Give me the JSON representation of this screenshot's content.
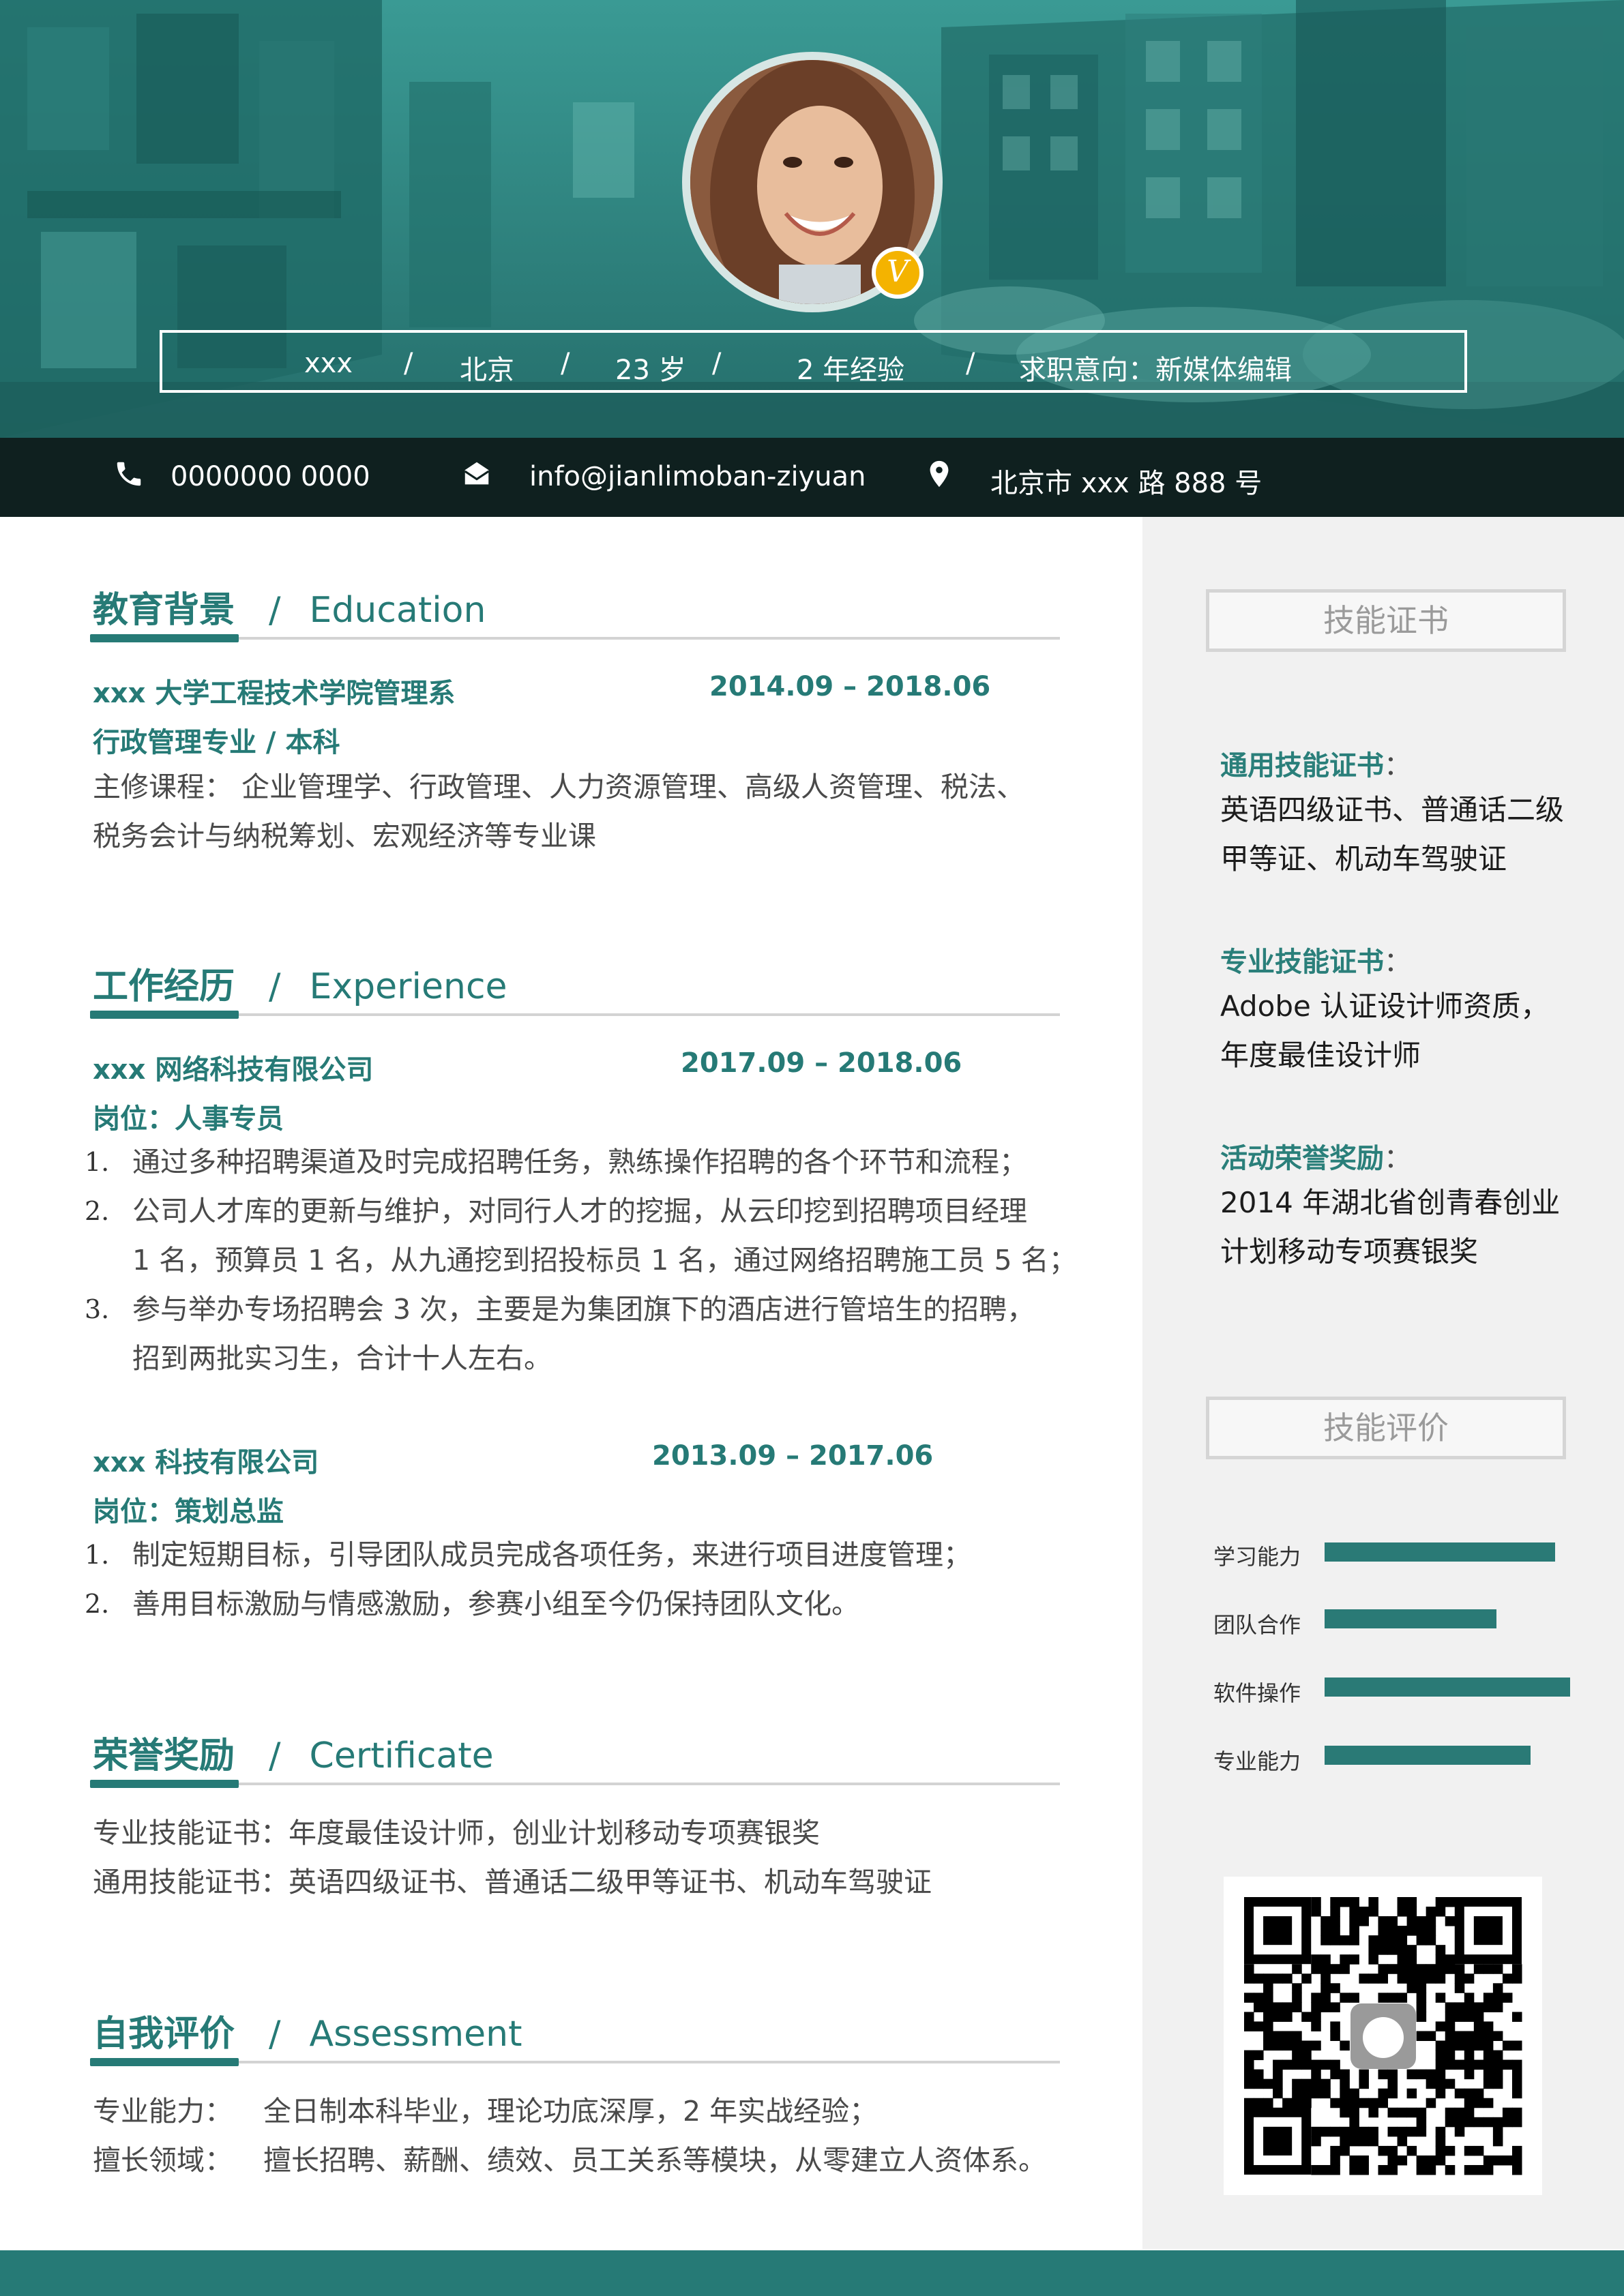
{
  "header": {
    "name": "xxx",
    "city": "北京",
    "age": "23 岁",
    "experience": "2 年经验",
    "intention": "求职意向：新媒体编辑",
    "separator": "/",
    "badge": "V"
  },
  "contact": {
    "phone": "0000000 0000",
    "email": "info@jianlimoban-ziyuan",
    "address": "北京市 xxx 路 888 号",
    "phone_icon": "phone-icon",
    "email_icon": "envelope-icon",
    "address_icon": "location-pin-icon"
  },
  "education": {
    "title_cn": "教育背景",
    "title_en": "Education",
    "school": "xxx 大学工程技术学院管理系",
    "period": "2014.09 – 2018.06",
    "major": "行政管理专业 / 本科",
    "courses_line1": "主修课程：  企业管理学、行政管理、人力资源管理、高级人资管理、税法、",
    "courses_line2": "税务会计与纳税筹划、宏观经济等专业课"
  },
  "experience": {
    "title_cn": "工作经历",
    "title_en": "Experience",
    "jobs": [
      {
        "company": "xxx 网络科技有限公司",
        "period": "2017.09 – 2018.06",
        "position": "岗位：人事专员",
        "items": [
          {
            "num": "1.",
            "lines": [
              "通过多种招聘渠道及时完成招聘任务，熟练操作招聘的各个环节和流程；"
            ]
          },
          {
            "num": "2.",
            "lines": [
              "公司人才库的更新与维护，对同行人才的挖掘，从云印挖到招聘项目经理",
              "1 名，预算员 1 名，从九通挖到招投标员 1 名，通过网络招聘施工员 5 名；"
            ]
          },
          {
            "num": "3.",
            "lines": [
              "参与举办专场招聘会 3 次，主要是为集团旗下的酒店进行管培生的招聘，",
              "招到两批实习生，合计十人左右。"
            ]
          }
        ]
      },
      {
        "company": "xxx 科技有限公司",
        "period": "2013.09 – 2017.06",
        "position": "岗位：策划总监",
        "items": [
          {
            "num": "1.",
            "lines": [
              "制定短期目标，引导团队成员完成各项任务，来进行项目进度管理；"
            ]
          },
          {
            "num": "2.",
            "lines": [
              "善用目标激励与情感激励，参赛小组至今仍保持团队文化。"
            ]
          }
        ]
      }
    ]
  },
  "honors": {
    "title_cn": "荣誉奖励",
    "title_en": "Certificate",
    "line1": "专业技能证书：年度最佳设计师，创业计划移动专项赛银奖",
    "line2": "通用技能证书：英语四级证书、普通话二级甲等证书、机动车驾驶证"
  },
  "assessment": {
    "title_cn": "自我评价",
    "title_en": "Assessment",
    "label1": "专业能力：",
    "text1": "全日制本科毕业，理论功底深厚，2  年实战经验；",
    "label2": "擅长领域：",
    "text2": "擅长招聘、薪酬、绩效、员工关系等模块，从零建立人资体系。"
  },
  "sidebar": {
    "cert_title": "技能证书",
    "certs": [
      {
        "label": "通用技能证书",
        "lines": [
          "英语四级证书、普通话二级",
          "甲等证、机动车驾驶证"
        ]
      },
      {
        "label": "专业技能证书",
        "lines": [
          "Adobe 认证设计师资质，",
          "年度最佳设计师"
        ]
      },
      {
        "label": "活动荣誉奖励",
        "lines": [
          "2014 年湖北省创青春创业",
          "计划移动专项赛银奖"
        ]
      }
    ],
    "colon": "：",
    "skill_title": "技能评价",
    "skills": [
      {
        "label": "学习能力",
        "level": 0.94
      },
      {
        "label": "团队合作",
        "level": 0.7
      },
      {
        "label": "软件操作",
        "level": 1.0
      },
      {
        "label": "专业能力",
        "level": 0.84
      }
    ]
  },
  "colors": {
    "accent": "#267a76",
    "contact_bar": "#0f201f",
    "sidebar_bg": "#f1f1f1",
    "badge": "#f4b300"
  }
}
